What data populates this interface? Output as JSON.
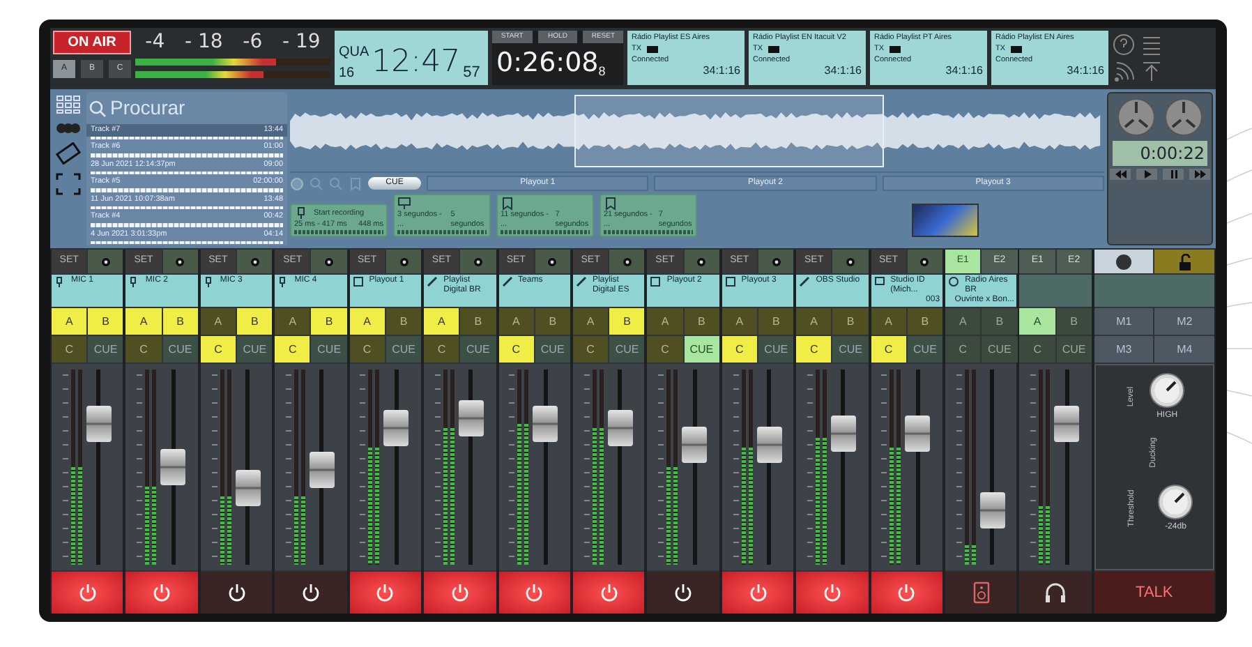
{
  "on_air": {
    "label": "ON AIR",
    "on": true
  },
  "bus_buttons": [
    {
      "label": "A",
      "selected": true
    },
    {
      "label": "B",
      "selected": false
    },
    {
      "label": "C",
      "selected": false
    }
  ],
  "master_meters": [
    {
      "peak": "-4",
      "rms": "- 18",
      "level": 0.72
    },
    {
      "peak": "-6",
      "rms": "- 19",
      "level": 0.66
    }
  ],
  "clock": {
    "day": "QUA",
    "date": "16",
    "time": "12:47",
    "seconds": "57"
  },
  "timer": {
    "buttons": [
      "START",
      "HOLD",
      "RESET"
    ],
    "time": "0:26:08",
    "tenths": "8"
  },
  "streams": [
    {
      "title": "Rádio Playlist ES Aires",
      "tx": "TX",
      "status": "Connected",
      "time": "34:1:16"
    },
    {
      "title": "Rádio Playlist EN Itacuit V2",
      "tx": "TX",
      "status": "Connected",
      "time": "34:1:16"
    },
    {
      "title": "Rádio Playlist PT Aires",
      "tx": "TX",
      "status": "Connected",
      "time": "34:1:16"
    },
    {
      "title": "Rádio Playlist EN Aires",
      "tx": "TX",
      "status": "Connected",
      "time": "34:1:16"
    }
  ],
  "browser": {
    "search_placeholder": "Procurar",
    "tracks": [
      {
        "title": "Track #7",
        "duration": "13:44",
        "selected": true
      },
      {
        "title": "Track #6",
        "duration": "01:00",
        "selected": false
      },
      {
        "title": "28 Jun 2021 12:14:37pm",
        "duration": "09:00",
        "selected": false
      },
      {
        "title": "Track #5",
        "duration": "02:00:00",
        "selected": false
      },
      {
        "title": "11 Jun 2021 10:07:38am",
        "duration": "13:48",
        "selected": false
      },
      {
        "title": "Track #4",
        "duration": "00:42",
        "selected": false
      },
      {
        "title": "4 Jun 2021 3:01:33pm",
        "duration": "04:14",
        "selected": false
      }
    ]
  },
  "recorder": {
    "time": "0:00:22"
  },
  "deck": {
    "cue": "CUE",
    "playouts": [
      "Playout 1",
      "Playout 2",
      "Playout 3"
    ]
  },
  "carts": [
    {
      "kind": "mic",
      "title": "Start recording",
      "range": "25 ms - 417 ms",
      "end": "448 ms"
    },
    {
      "kind": "screen",
      "range": "3 segundos - ...",
      "end": "5 segundos"
    },
    {
      "kind": "bookmark",
      "range": "11 segundos - ...",
      "end": "7 segundos"
    },
    {
      "kind": "bookmark",
      "range": "21 segundos - ...",
      "end": "7 segundos"
    }
  ],
  "channels": [
    {
      "kind": "set",
      "set_label": "SET",
      "label": {
        "kind": "mic",
        "name": "MIC 1"
      },
      "routes": [
        {
          "label": "A",
          "on": true
        },
        {
          "label": "B",
          "on": true
        },
        {
          "label": "C",
          "on": false
        },
        {
          "label": "CUE",
          "on": false
        }
      ],
      "fader": {
        "level": 0.77
      },
      "meter": {
        "level": 0.5
      },
      "bottom_button": {
        "kind": "power",
        "on": true
      }
    },
    {
      "kind": "set",
      "set_label": "SET",
      "label": {
        "kind": "mic",
        "name": "MIC 2"
      },
      "routes": [
        {
          "label": "A",
          "on": true
        },
        {
          "label": "B",
          "on": true
        },
        {
          "label": "C",
          "on": false
        },
        {
          "label": "CUE",
          "on": false
        }
      ],
      "fader": {
        "level": 0.5
      },
      "meter": {
        "level": 0.4
      },
      "bottom_button": {
        "kind": "power",
        "on": true
      }
    },
    {
      "kind": "set",
      "set_label": "SET",
      "label": {
        "kind": "mic",
        "name": "MIC 3"
      },
      "routes": [
        {
          "label": "A",
          "on": false
        },
        {
          "label": "B",
          "on": true
        },
        {
          "label": "C",
          "on": true
        },
        {
          "label": "CUE",
          "on": false
        }
      ],
      "fader": {
        "level": 0.37
      },
      "meter": {
        "level": 0.35
      },
      "bottom_button": {
        "kind": "power",
        "on": false
      }
    },
    {
      "kind": "set",
      "set_label": "SET",
      "label": {
        "kind": "mic",
        "name": "MIC 4"
      },
      "routes": [
        {
          "label": "A",
          "on": false
        },
        {
          "label": "B",
          "on": true
        },
        {
          "label": "C",
          "on": true
        },
        {
          "label": "CUE",
          "on": false
        }
      ],
      "fader": {
        "level": 0.48
      },
      "meter": {
        "level": 0.35
      },
      "bottom_button": {
        "kind": "power",
        "on": false
      }
    },
    {
      "kind": "set",
      "set_label": "SET",
      "label": {
        "kind": "playout",
        "name": "Playout 1"
      },
      "routes": [
        {
          "label": "A",
          "on": true
        },
        {
          "label": "B",
          "on": false
        },
        {
          "label": "C",
          "on": false
        },
        {
          "label": "CUE",
          "on": false
        }
      ],
      "fader": {
        "level": 0.75
      },
      "meter": {
        "level": 0.6
      },
      "bottom_button": {
        "kind": "power",
        "on": true
      }
    },
    {
      "kind": "set",
      "set_label": "SET",
      "label": {
        "kind": "playlist",
        "name": "Playlist Digital BR"
      },
      "routes": [
        {
          "label": "A",
          "on": true
        },
        {
          "label": "B",
          "on": false
        },
        {
          "label": "C",
          "on": false
        },
        {
          "label": "CUE",
          "on": false
        }
      ],
      "fader": {
        "level": 0.81
      },
      "meter": {
        "level": 0.7
      },
      "bottom_button": {
        "kind": "power",
        "on": true
      }
    },
    {
      "kind": "set",
      "set_label": "SET",
      "label": {
        "kind": "playlist",
        "name": "Teams"
      },
      "routes": [
        {
          "label": "A",
          "on": false
        },
        {
          "label": "B",
          "on": false
        },
        {
          "label": "C",
          "on": true
        },
        {
          "label": "CUE",
          "on": false
        }
      ],
      "fader": {
        "level": 0.77
      },
      "meter": {
        "level": 0.72
      },
      "bottom_button": {
        "kind": "power",
        "on": true
      }
    },
    {
      "kind": "set",
      "set_label": "SET",
      "label": {
        "kind": "playlist",
        "name": "Playlist Digital ES"
      },
      "routes": [
        {
          "label": "A",
          "on": false
        },
        {
          "label": "B",
          "on": true
        },
        {
          "label": "C",
          "on": false
        },
        {
          "label": "CUE",
          "on": false
        }
      ],
      "fader": {
        "level": 0.75
      },
      "meter": {
        "level": 0.7
      },
      "bottom_button": {
        "kind": "power",
        "on": true
      }
    },
    {
      "kind": "set",
      "set_label": "SET",
      "label": {
        "kind": "playout",
        "name": "Playout 2"
      },
      "routes": [
        {
          "label": "A",
          "on": false
        },
        {
          "label": "B",
          "on": false
        },
        {
          "label": "C",
          "on": false
        },
        {
          "label": "CUE",
          "on": true
        }
      ],
      "fader": {
        "level": 0.64
      },
      "meter": {
        "level": 0.5
      },
      "bottom_button": {
        "kind": "power",
        "on": false
      }
    },
    {
      "kind": "set",
      "set_label": "SET",
      "label": {
        "kind": "playout",
        "name": "Playout 3"
      },
      "routes": [
        {
          "label": "A",
          "on": false
        },
        {
          "label": "B",
          "on": false
        },
        {
          "label": "C",
          "on": true
        },
        {
          "label": "CUE",
          "on": false
        }
      ],
      "fader": {
        "level": 0.64
      },
      "meter": {
        "level": 0.6
      },
      "bottom_button": {
        "kind": "power",
        "on": true
      }
    },
    {
      "kind": "set",
      "set_label": "SET",
      "label": {
        "kind": "playlist",
        "name": "OBS Studio"
      },
      "routes": [
        {
          "label": "A",
          "on": false
        },
        {
          "label": "B",
          "on": false
        },
        {
          "label": "C",
          "on": true
        },
        {
          "label": "CUE",
          "on": false
        }
      ],
      "fader": {
        "level": 0.71
      },
      "meter": {
        "level": 0.65
      },
      "bottom_button": {
        "kind": "power",
        "on": true
      }
    },
    {
      "kind": "set",
      "set_label": "SET",
      "label": {
        "kind": "screen",
        "name": "Studio ID (Mich...",
        "subtitle": "003"
      },
      "routes": [
        {
          "label": "A",
          "on": false
        },
        {
          "label": "B",
          "on": false
        },
        {
          "label": "C",
          "on": true
        },
        {
          "label": "CUE",
          "on": false
        }
      ],
      "fader": {
        "level": 0.71
      },
      "meter": {
        "level": 0.6
      },
      "bottom_button": {
        "kind": "power",
        "on": true
      }
    },
    {
      "kind": "ext",
      "ext_buttons": [
        {
          "label": "E1",
          "selected": true
        },
        {
          "label": "E2",
          "selected": false
        }
      ],
      "label": {
        "kind": "radio",
        "name": "Radio Aires BR",
        "subtitle": "Ouvinte x Bon..."
      },
      "routes": [
        {
          "label": "A",
          "on": false
        },
        {
          "label": "B",
          "on": false
        },
        {
          "label": "C",
          "on": false
        },
        {
          "label": "CUE",
          "on": false
        }
      ],
      "fader": {
        "level": 0.23
      },
      "meter": {
        "level": 0.1
      },
      "bottom_button": {
        "kind": "speaker",
        "on": false
      }
    },
    {
      "kind": "ext",
      "ext_buttons": [
        {
          "label": "E1",
          "selected": false
        },
        {
          "label": "E2",
          "selected": false
        }
      ],
      "routes": [
        {
          "label": "A",
          "on": true
        },
        {
          "label": "B",
          "on": false
        },
        {
          "label": "C",
          "on": false
        },
        {
          "label": "CUE",
          "on": false
        }
      ],
      "fader": {
        "level": 0.77
      },
      "meter": {
        "level": 0.3
      },
      "bottom_button": {
        "kind": "headphones",
        "on": false
      }
    }
  ],
  "monitor": {
    "buttons": [
      "M1",
      "M2",
      "M3",
      "M4"
    ],
    "knobs": [
      {
        "label": "Level",
        "value": "HIGH"
      },
      {
        "label": "Threshold",
        "value": "-24db"
      }
    ],
    "ducking": "Ducking",
    "talk": "TALK"
  }
}
